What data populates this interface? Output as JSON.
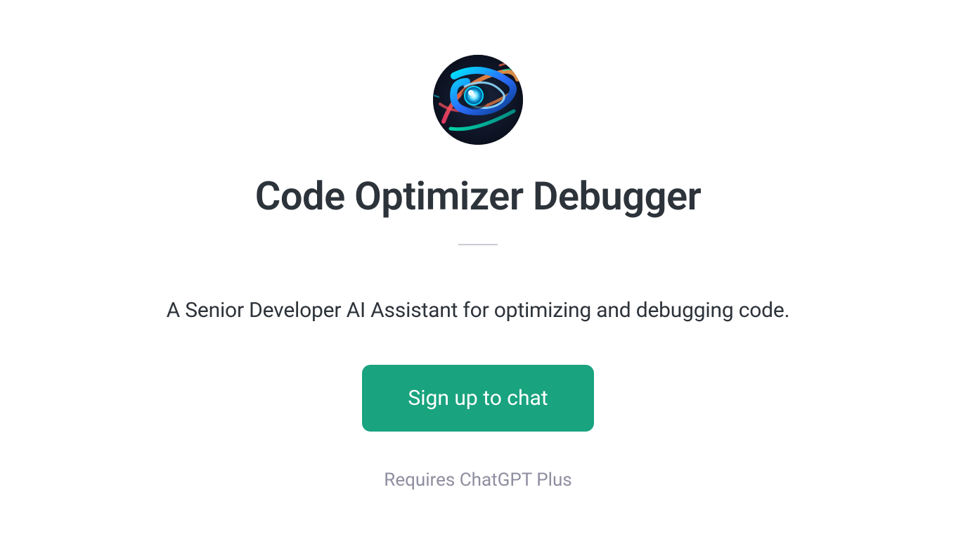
{
  "header": {
    "title": "Code Optimizer Debugger",
    "subtitle": "A Senior Developer AI Assistant for optimizing and debugging code."
  },
  "cta": {
    "label": "Sign up to chat"
  },
  "footer": {
    "note": "Requires ChatGPT Plus"
  },
  "icon": {
    "name": "futuristic-tech-avatar"
  }
}
